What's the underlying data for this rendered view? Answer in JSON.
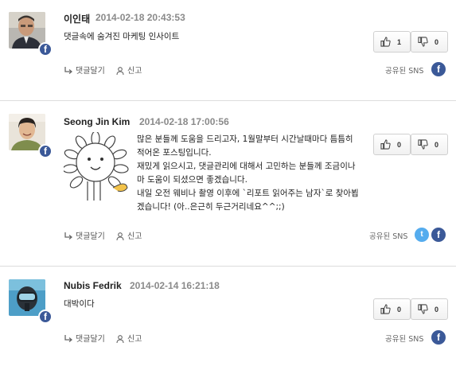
{
  "comments": [
    {
      "author": "이인태",
      "date": "2014-02-18 20:43:53",
      "body": [
        "댓글속에 숨겨진 마케팅 인사이트"
      ],
      "likes": "1",
      "dislikes": "0",
      "reply_label": "댓글달기",
      "report_label": "신고",
      "share_label": "공유된 SNS",
      "shared_sns": [
        "facebook"
      ]
    },
    {
      "author": "Seong Jin Kim",
      "date": "2014-02-18 17:00:56",
      "body": [
        "많은 분들께 도움을 드리고자, 1월말부터 시간날때마다 틈틈히",
        "적어온 포스팅입니다.",
        "재밌게 읽으시고, 댓글관리에 대해서 고민하는 분들께 조금이나",
        "마 도움이 되셨으면 좋겠습니다.",
        "내일 오전 웨비나 촬영 이후에 `리포트 읽어주는 남자`로 찾아뵙",
        "겠습니다! (아..은근히 두근거리네요^^;;)"
      ],
      "likes": "0",
      "dislikes": "0",
      "reply_label": "댓글달기",
      "report_label": "신고",
      "share_label": "공유된 SNS",
      "shared_sns": [
        "twitter",
        "facebook"
      ]
    },
    {
      "author": "Nubis Fedrik",
      "date": "2014-02-14 16:21:18",
      "body": [
        "대박이다"
      ],
      "likes": "0",
      "dislikes": "0",
      "reply_label": "댓글달기",
      "report_label": "신고",
      "share_label": "공유된 SNS",
      "shared_sns": [
        "facebook"
      ]
    }
  ],
  "icons": {
    "facebook_glyph": "f",
    "twitter_glyph": "t"
  },
  "colors": {
    "facebook": "#3b5998",
    "twitter": "#55acee",
    "divider": "#dcdcdc",
    "date": "#8a8a8a"
  }
}
